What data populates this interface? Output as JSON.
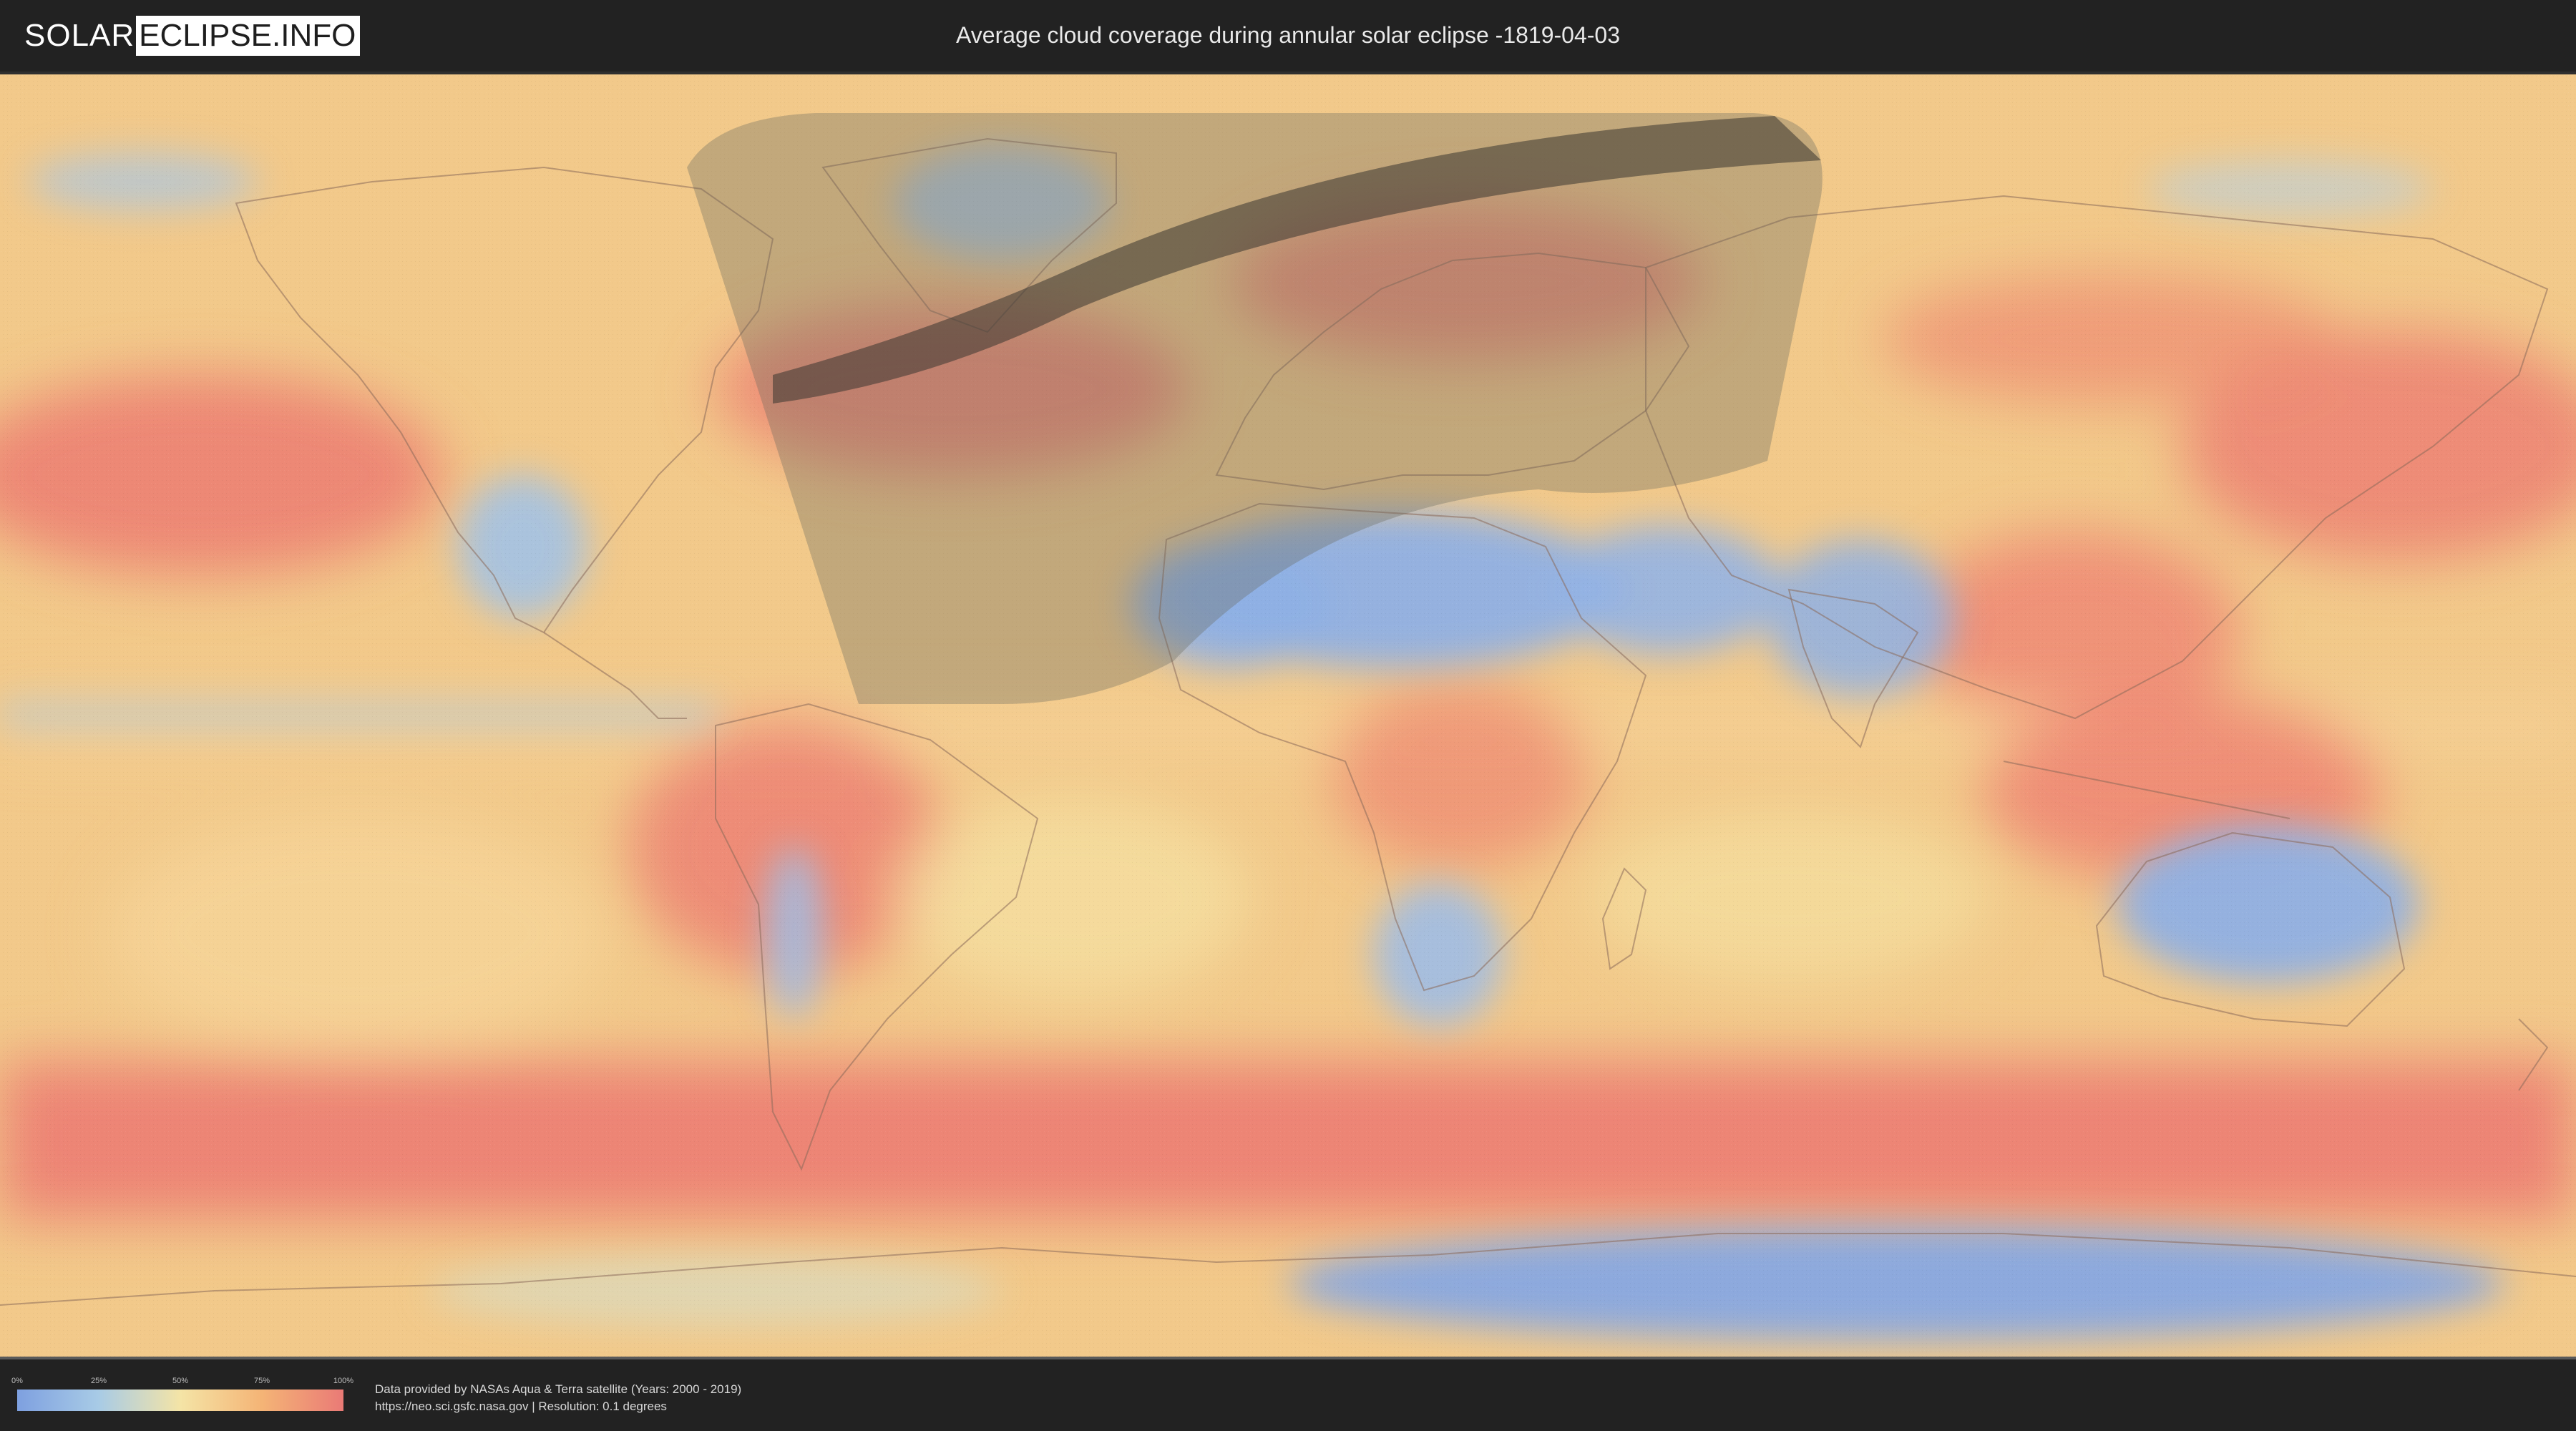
{
  "header": {
    "logo_left": "SOLAR",
    "logo_right": "ECLIPSE.INFO",
    "title": "Average cloud coverage during annular solar eclipse -1819-04-03"
  },
  "legend": {
    "ticks": [
      "0%",
      "25%",
      "50%",
      "75%",
      "100%"
    ],
    "colors": [
      "#7ea0e0",
      "#a8cbe6",
      "#f4e4a6",
      "#f4b476",
      "#ea7a76"
    ]
  },
  "footer": {
    "credit_line1": "Data provided by NASAs Aqua & Terra satellite (Years: 2000 - 2019)",
    "credit_line2": "https://neo.sci.gsfc.nasa.gov | Resolution: 0.1 degrees"
  },
  "map": {
    "projection": "equirectangular world map",
    "overlays": [
      "eclipse-visibility-zone",
      "annularity-path"
    ]
  }
}
